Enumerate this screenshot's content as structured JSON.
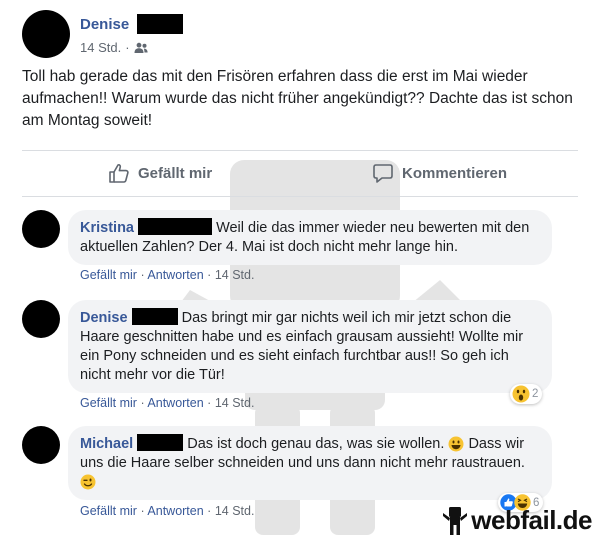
{
  "post": {
    "author": "Denise",
    "time": "14 Std.",
    "privacy_icon": "friends-icon",
    "text": "Toll hab gerade das mit den Frisören erfahren dass die erst im Mai wieder aufmachen!! Warum wurde das nicht früher angekündigt?? Dachte das ist schon am Montag soweit!",
    "like_label": "Gefällt mir",
    "comment_label": "Kommentieren"
  },
  "comments": [
    {
      "name": "Kristina",
      "text": "Weil die das immer wieder neu bewerten mit den aktuellen Zahlen? Der 4. Mai ist doch nicht mehr lange hin.",
      "like": "Gefällt mir",
      "reply": "Antworten",
      "time": "14 Std."
    },
    {
      "name": "Denise",
      "text": "Das bringt mir gar nichts weil ich mir jetzt schon die Haare geschnitten habe und es einfach grausam aussieht! Wollte mir ein Pony schneiden und es sieht einfach furchtbar aus!! So geh ich nicht mehr vor die Tür!",
      "like": "Gefällt mir",
      "reply": "Antworten",
      "time": "14 Std.",
      "reaction_count": "2"
    },
    {
      "name": "Michael",
      "text_a": "Das ist doch genau das, was sie wollen.",
      "text_b": "Dass wir uns die Haare selber schneiden und uns dann nicht mehr raustrauen.",
      "like": "Gefällt mir",
      "reply": "Antworten",
      "time": "14 Std.",
      "reaction_count": "6"
    }
  ],
  "separator": "·",
  "watermark": "webfail.de",
  "colors": {
    "name_blue": "#385898",
    "meta_gray": "#606770",
    "bubble_bg": "#f2f3f5"
  }
}
